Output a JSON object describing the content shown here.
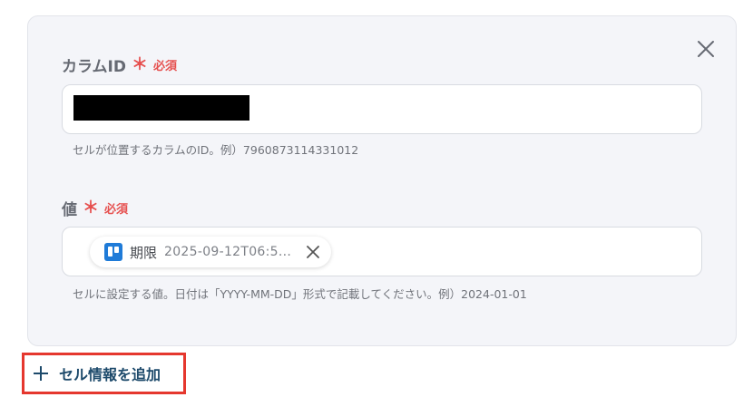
{
  "column_id": {
    "label": "カラムID",
    "required_mark": "＊",
    "required_text": "必須",
    "help": "セルが位置するカラムのID。例）7960873114331012"
  },
  "value": {
    "label": "値",
    "required_mark": "＊",
    "required_text": "必須",
    "chip": {
      "name": "期限",
      "value": "2025-09-12T06:5...",
      "icon": "trello-icon"
    },
    "help": "セルに設定する値。日付は「YYYY-MM-DD」形式で記載してください。例）2024-01-01"
  },
  "actions": {
    "add_cell_label": "セル情報を追加",
    "close_icon": "close-icon"
  },
  "colors": {
    "required": "#e6504f",
    "accent": "#1f7bd8",
    "highlight_border": "#e5372e",
    "link": "#1d4a6b"
  }
}
